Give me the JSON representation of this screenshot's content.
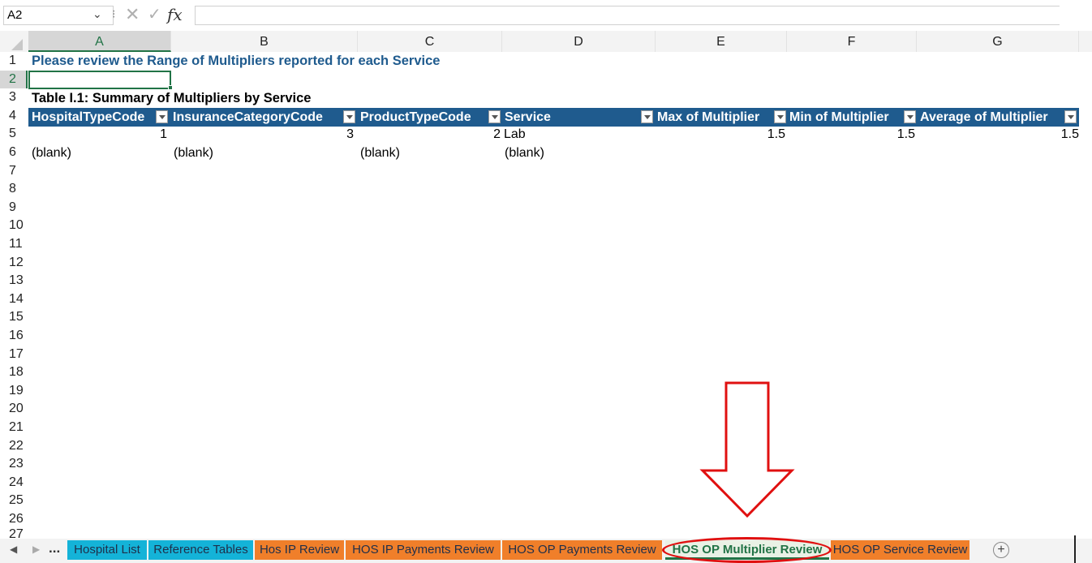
{
  "formula_bar": {
    "name_box": "A2",
    "dropdown_glyph": "⌄",
    "separator": "⁝",
    "cancel_glyph": "✕",
    "enter_glyph": "✓",
    "fx_label": "fx",
    "formula_value": ""
  },
  "columns": [
    "A",
    "B",
    "C",
    "D",
    "E",
    "F",
    "G"
  ],
  "selected_column": "A",
  "rows": [
    "1",
    "2",
    "3",
    "4",
    "5",
    "6",
    "7",
    "8",
    "9",
    "10",
    "11",
    "12",
    "13",
    "14",
    "15",
    "16",
    "17",
    "18",
    "19",
    "20",
    "21",
    "22",
    "23",
    "24",
    "25",
    "26",
    "27"
  ],
  "selected_row": "2",
  "sheet": {
    "title": "Please review the Range of Multipliers reported for each Service",
    "table_title": "Table I.1: Summary of Multipliers by Service"
  },
  "pivot": {
    "headers": [
      "HospitalTypeCode",
      "InsuranceCategoryCode",
      "ProductTypeCode",
      "Service",
      "Max of Multiplier",
      "Min of Multiplier",
      "Average of Multiplier"
    ],
    "header_color": "#1f5b8e",
    "rows": [
      [
        "1",
        "3",
        "2",
        "Lab",
        "1.5",
        "1.5",
        "1.5"
      ],
      [
        "(blank)",
        "(blank)",
        "(blank)",
        "(blank)",
        "",
        "",
        ""
      ]
    ]
  },
  "tabs": {
    "nav_prev": "◀",
    "nav_next": "▶",
    "more": "...",
    "add_sheet": "+",
    "items": [
      {
        "label": "Hospital List",
        "color": "#14b3d8"
      },
      {
        "label": "Reference Tables",
        "color": "#14b3d8"
      },
      {
        "label": "Hos IP Review",
        "color": "#f07f2a"
      },
      {
        "label": "HOS IP Payments Review",
        "color": "#f07f2a"
      },
      {
        "label": "HOS OP Payments Review",
        "color": "#f07f2a"
      },
      {
        "label": "HOS OP Multiplier Review",
        "color": "#e9f1e5",
        "active": true
      },
      {
        "label": "HOS OP Service Review",
        "color": "#f07f2a"
      }
    ]
  },
  "annotation": {
    "color": "#e01010",
    "arrow": "down-arrow-icon",
    "highlight": "ellipse around active sheet tab"
  },
  "icons": [
    "chevron-down-icon",
    "cancel-icon",
    "enter-icon",
    "fx-icon",
    "filter-dropdown-icon",
    "add-sheet-icon",
    "nav-prev-icon",
    "nav-next-icon"
  ]
}
